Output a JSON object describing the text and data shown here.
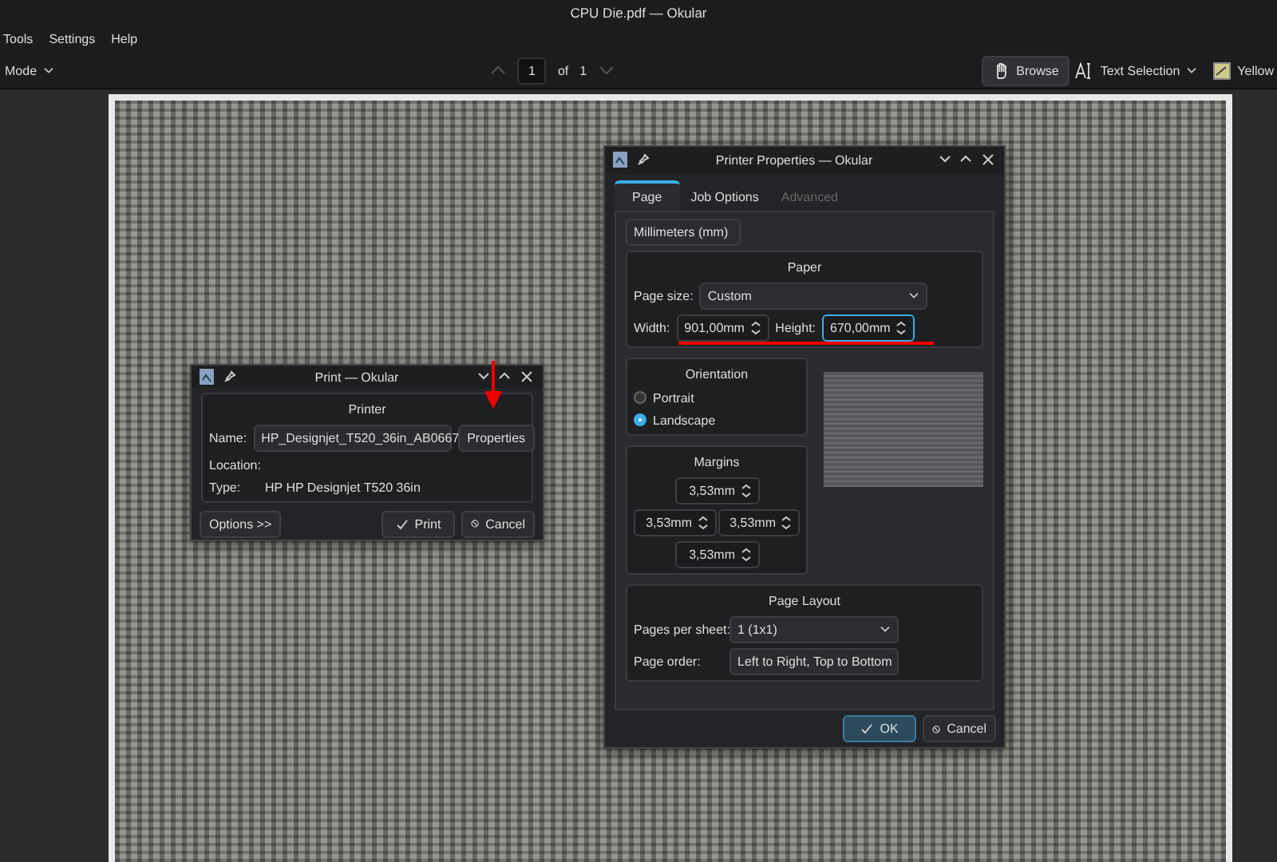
{
  "window": {
    "title": "CPU Die.pdf — Okular"
  },
  "menu": [
    "Tools",
    "Settings",
    "Help"
  ],
  "toolbar": {
    "view_mode": "Mode",
    "page": "1",
    "of": "of",
    "total": "1",
    "tools": [
      {
        "label": "Browse",
        "selected": true
      },
      {
        "label": "Text Selection",
        "selected": false
      },
      {
        "label": "Yellow",
        "selected": false
      }
    ]
  },
  "print_dialog": {
    "title": "Print — Okular",
    "group": "Printer",
    "name_label": "Name:",
    "name_value": "HP_Designjet_T520_36in_AB0667",
    "properties_button": "Properties",
    "location_label": "Location:",
    "type_label": "Type:",
    "type_value": "HP HP Designjet T520 36in",
    "options_button": "Options >>",
    "print_button": "Print",
    "cancel_button": "Cancel"
  },
  "properties_dialog": {
    "title": "Printer Properties — Okular",
    "tabs": [
      {
        "label": "Page",
        "selected": true,
        "disabled": false
      },
      {
        "label": "Job Options",
        "selected": false,
        "disabled": false
      },
      {
        "label": "Advanced",
        "selected": false,
        "disabled": true
      }
    ],
    "units": "Millimeters (mm)",
    "paper": {
      "title": "Paper",
      "size_label": "Page size:",
      "size_value": "Custom",
      "width_label": "Width:",
      "width_value": "901,00mm",
      "width_focused": false,
      "height_label": "Height:",
      "height_value": "670,00mm",
      "height_focused": true
    },
    "orientation": {
      "title": "Orientation",
      "options": [
        {
          "label": "Portrait",
          "selected": false
        },
        {
          "label": "Landscape",
          "selected": true
        }
      ]
    },
    "margins": {
      "title": "Margins",
      "top": "3,53mm",
      "left": "3,53mm",
      "right": "3,53mm",
      "bottom": "3,53mm"
    },
    "layout": {
      "title": "Page Layout",
      "per_sheet_label": "Pages per sheet:",
      "per_sheet_value": "1 (1x1)",
      "order_label": "Page order:",
      "order_value": "Left to Right, Top to Bottom"
    },
    "ok_button": "OK",
    "cancel_button": "Cancel"
  }
}
